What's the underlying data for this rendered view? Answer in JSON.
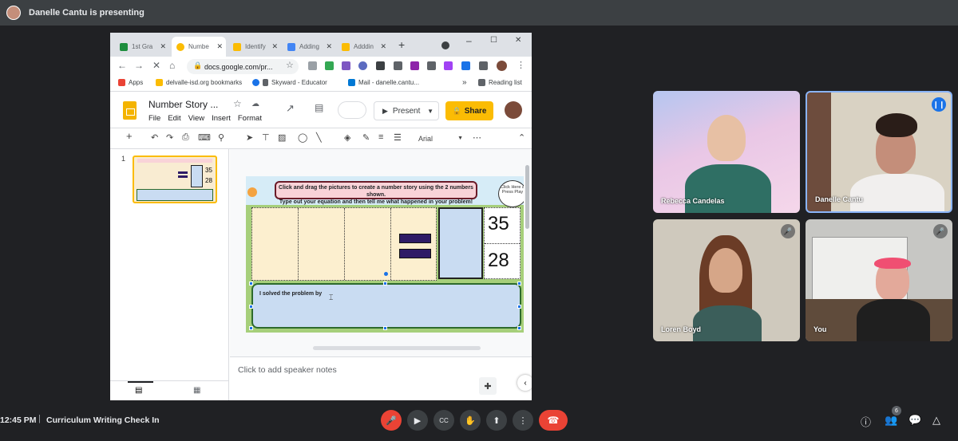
{
  "presenter_banner": {
    "text": "Danelle Cantu is presenting"
  },
  "browser": {
    "tabs": [
      {
        "label": "1st Gra",
        "icon": "google-drive-icon",
        "color": "#1e8e3e"
      },
      {
        "label": "Numbe",
        "icon": "google-slides-icon",
        "color": "#fbbc04"
      },
      {
        "label": "Identify",
        "icon": "google-slides-icon",
        "color": "#fbbc04"
      },
      {
        "label": "Adding",
        "icon": "google-docs-icon",
        "color": "#4285f4"
      },
      {
        "label": "Adddin",
        "icon": "google-slides-icon",
        "color": "#fbbc04"
      }
    ],
    "new_tab": "+",
    "url": "docs.google.com/pr...",
    "bookmarks": [
      {
        "label": "Apps"
      },
      {
        "label": "delvalle-isd.org bookmarks"
      },
      {
        "label": "Skyward - Educator"
      },
      {
        "label": "Mail - danelle.cantu..."
      }
    ],
    "bookmarks_more": "»",
    "reading_list": "Reading list"
  },
  "slides": {
    "doc_title": "Number Story ...",
    "menu": [
      "File",
      "Edit",
      "View",
      "Insert",
      "Format"
    ],
    "present_label": "Present",
    "share_label": "Share",
    "font": "Arial",
    "slide_number": "1",
    "slide": {
      "instruction_line1": "Click and drag the pictures to create a number story using the 2 numbers shown.",
      "instruction_line2": "Type out your equation and then tell me what happened in your problem!",
      "bubble_text": "Click Here a Press Play",
      "number_top": "35",
      "number_bottom": "28",
      "solve_label": "I solved the problem by"
    },
    "thumb_numbers": [
      "35",
      "28"
    ],
    "speaker_notes_placeholder": "Click to add speaker notes"
  },
  "participants": [
    {
      "name": "Rebecca Candelas",
      "muted": false
    },
    {
      "name": "Danelle Cantu",
      "muted": false,
      "speaking": true
    },
    {
      "name": "Loren Boyd",
      "muted": true
    },
    {
      "name": "You",
      "muted": true
    }
  ],
  "meeting": {
    "time": "12:45 PM",
    "separator": "|",
    "title": "Curriculum Writing Check In",
    "people_count": "6"
  },
  "colors": {
    "accent_yellow": "#fbbc04",
    "meet_red": "#ea4335",
    "meet_bg": "#202124"
  }
}
